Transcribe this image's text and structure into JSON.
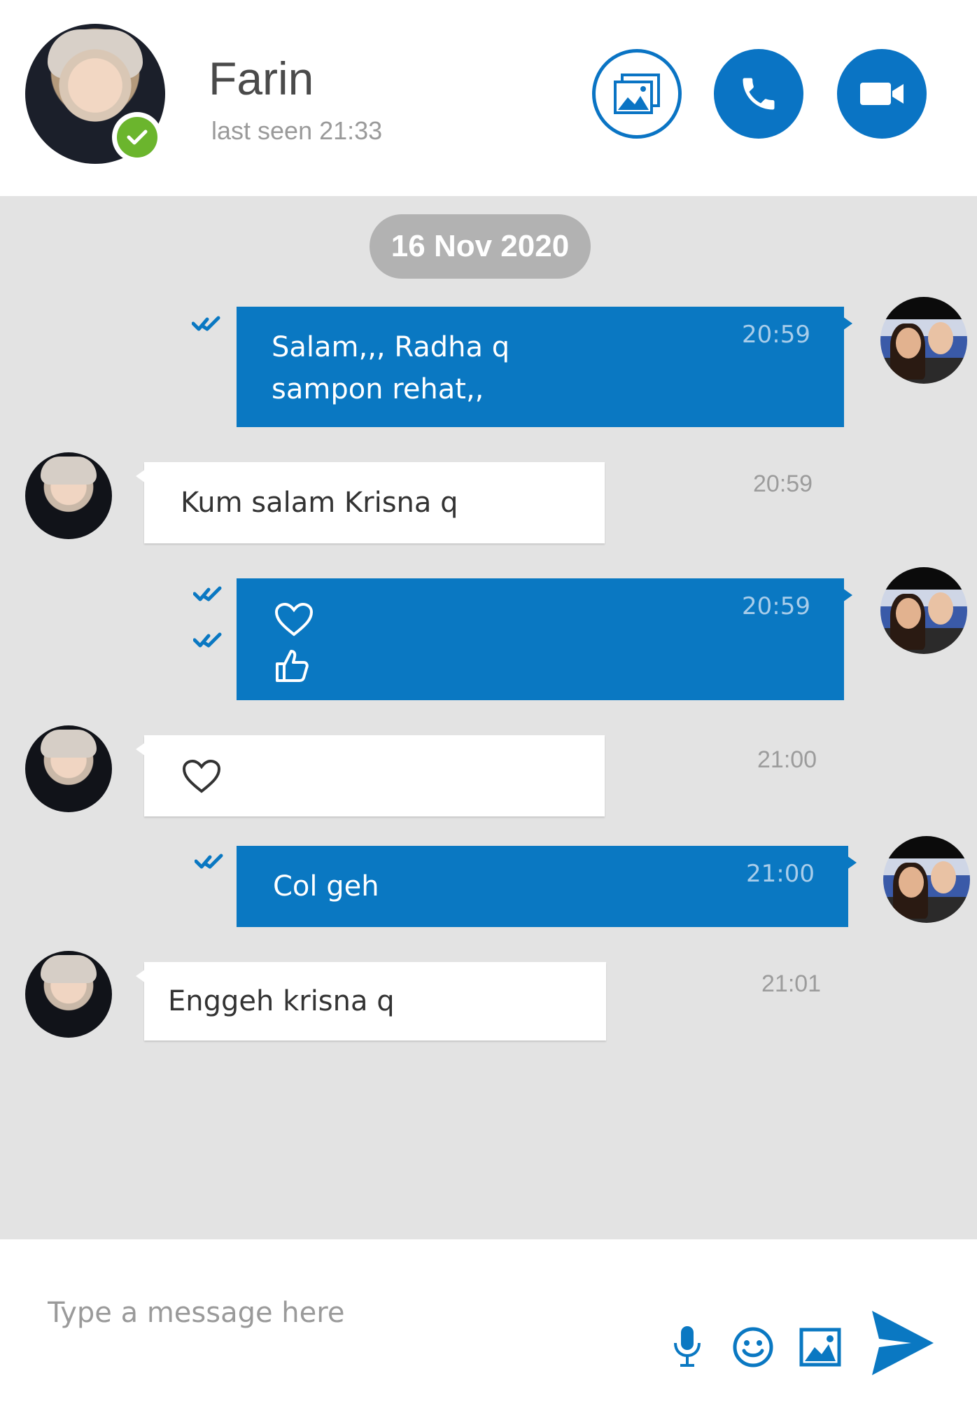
{
  "header": {
    "contact_name": "Farin",
    "last_seen": "last seen 21:33",
    "status": "online",
    "buttons": [
      {
        "name": "media-gallery",
        "icon": "image-icon"
      },
      {
        "name": "voice-call",
        "icon": "phone-icon"
      },
      {
        "name": "video-call",
        "icon": "video-camera-icon"
      }
    ]
  },
  "chat": {
    "date_separator": "16 Nov 2020",
    "messages": [
      {
        "direction": "outgoing",
        "lines": [
          "Salam,,, Radha q",
          "sampon rehat,,"
        ],
        "time": "20:59",
        "status": "double-tick"
      },
      {
        "direction": "incoming",
        "lines": [
          "Kum salam Krisna q"
        ],
        "time": "20:59"
      },
      {
        "direction": "outgoing",
        "emoji": [
          "heart-outline-icon",
          "thumbs-up-outline-icon"
        ],
        "time": "20:59",
        "status": "double-tick"
      },
      {
        "direction": "incoming",
        "emoji": [
          "heart-outline-icon"
        ],
        "time": "21:00"
      },
      {
        "direction": "outgoing",
        "lines": [
          "Col geh"
        ],
        "time": "21:00",
        "status": "double-tick"
      },
      {
        "direction": "incoming",
        "lines": [
          "Enggeh krisna q"
        ],
        "time": "21:01"
      }
    ]
  },
  "composer": {
    "placeholder": "Type a message here",
    "icons": [
      "microphone-icon",
      "smiley-icon",
      "image-icon",
      "send-icon"
    ]
  },
  "colors": {
    "accent": "#0a78c2",
    "online": "#6bb52d",
    "chat_background": "#e3e3e3",
    "date_pill": "#b2b2b2"
  }
}
